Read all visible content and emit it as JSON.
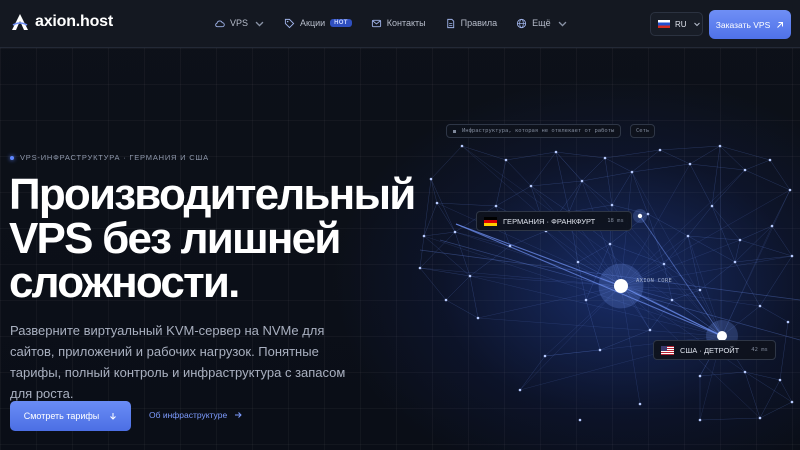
{
  "header": {
    "logo_text": "axion.host",
    "nav": [
      {
        "label": "VPS",
        "icon": "cloud-icon",
        "dropdown": true
      },
      {
        "label": "Акции",
        "icon": "tag-icon",
        "badge": "HOT"
      },
      {
        "label": "Контакты",
        "icon": "mail-icon"
      },
      {
        "label": "Правила",
        "icon": "document-icon"
      },
      {
        "label": "Ещё",
        "icon": "globe-icon",
        "dropdown": true
      }
    ],
    "language": "RU",
    "order_button": "Заказать VPS"
  },
  "hero": {
    "eyebrow": "VPS-ИНФРАСТРУКТУРА · ГЕРМАНИЯ И США",
    "headline_lines": [
      "Производительный",
      "VPS без лишней",
      "сложности."
    ],
    "description": "Разверните виртуальный KVM-сервер на NVMe для сайтов, приложений и рабочих нагрузок. Понятные тарифы, полный контроль и инфраструктура с запасом для роста.",
    "cta_primary": "Смотреть тарифы",
    "cta_secondary": "Об инфраструктуре"
  },
  "network": {
    "caption": "Инфраструктура, которая не отвлекает от работы",
    "caption_tag": "Сеть",
    "core_label": "AXION CORE",
    "locations": [
      {
        "label": "ГЕРМАНИЯ · ФРАНКФУРТ",
        "latency": "18 ms",
        "flag": "flag-de"
      },
      {
        "label": "США · ДЕТРОЙТ",
        "latency": "42 ms",
        "flag": "flag-us"
      }
    ]
  },
  "colors": {
    "background": "#0b0f18",
    "header": "#141821",
    "accent": "#5b7ef0",
    "link": "#7d9cff"
  }
}
